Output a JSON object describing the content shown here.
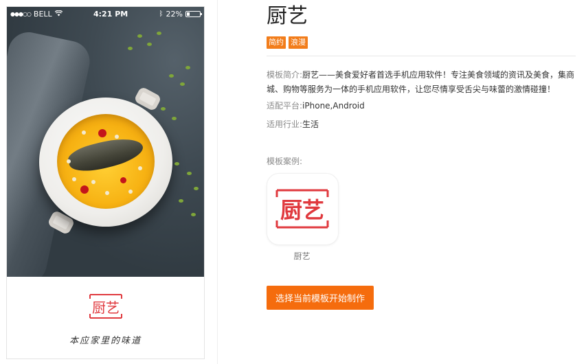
{
  "phone": {
    "status": {
      "carrier": "BELL",
      "signal_dots": "●●●○○",
      "time": "4:21 PM",
      "battery": "22%"
    },
    "logo_text": "厨艺",
    "slogan": "本应家里的味道"
  },
  "template": {
    "title": "厨艺",
    "tags": [
      "简约",
      "浪漫"
    ],
    "desc_label": "模板简介:",
    "desc": "厨艺——美食爱好者首选手机应用软件！专注美食领域的资讯及美食，集商城、购物等服务为一体的手机应用软件，让您尽情享受舌尖与味蕾的激情碰撞！",
    "platform_label": "适配平台:",
    "platform": "iPhone,Android",
    "industry_label": "适用行业:",
    "industry": "生活",
    "cases_label": "模板案例:",
    "case_name": "厨艺",
    "cta": "选择当前模板开始制作"
  },
  "colors": {
    "accent": "#f56c0d",
    "tag": "#f27d1b",
    "logo_red": "#e0393e"
  }
}
